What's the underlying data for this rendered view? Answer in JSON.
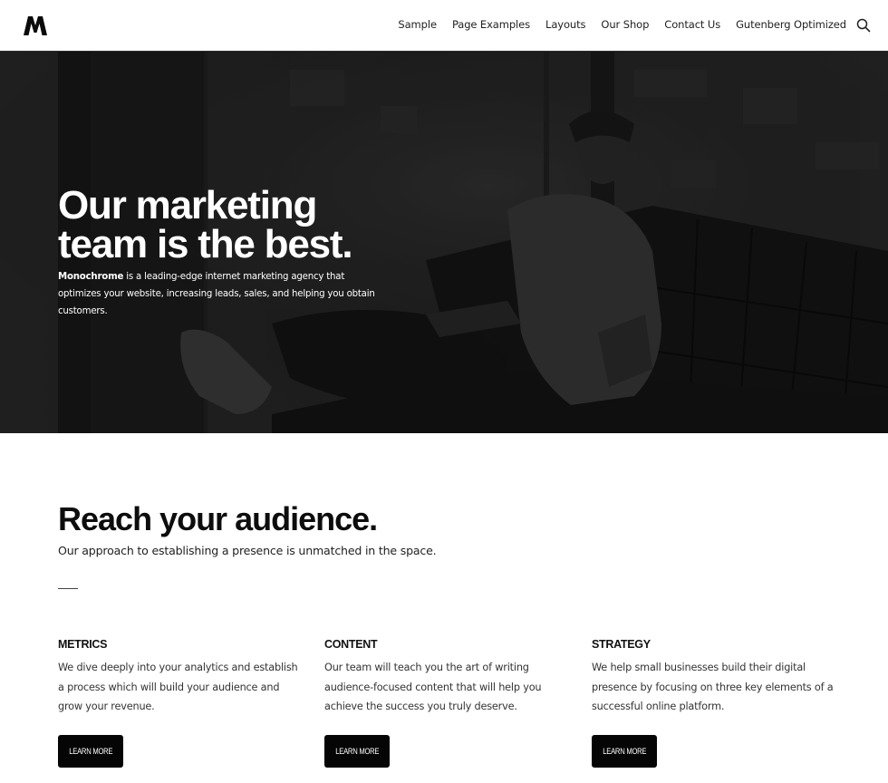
{
  "header": {
    "logo_letter": "M",
    "nav": [
      {
        "label": "Sample"
      },
      {
        "label": "Page Examples"
      },
      {
        "label": "Layouts"
      },
      {
        "label": "Our Shop"
      },
      {
        "label": "Contact Us"
      },
      {
        "label": "Gutenberg Optimized"
      }
    ],
    "search_icon": "search-icon"
  },
  "hero": {
    "title_line1": "Our marketing",
    "title_line2": "team is the best.",
    "brand": "Monochrome",
    "description": " is a leading-edge internet marketing agency that optimizes your website, increasing leads, sales, and helping you obtain customers.",
    "overlay_color": "#1a1a1a"
  },
  "section": {
    "title": "Reach your audience.",
    "subtitle": "Our approach to establishing a presence is unmatched in the space.",
    "columns": [
      {
        "title": "METRICS",
        "text": "We dive deeply into your analytics and establish a process which will build your audience and grow your revenue.",
        "button": "LEARN MORE"
      },
      {
        "title": "CONTENT",
        "text": "Our team will teach you the art of writing audience-focused content that will help you achieve the success you truly deserve.",
        "button": "LEARN MORE"
      },
      {
        "title": "STRATEGY",
        "text": "We help small businesses build their digital presence by focusing on three key elements of a successful online platform.",
        "button": "LEARN MORE"
      }
    ]
  },
  "colors": {
    "button_bg": "#050505",
    "text": "#111111",
    "background": "#ffffff"
  }
}
